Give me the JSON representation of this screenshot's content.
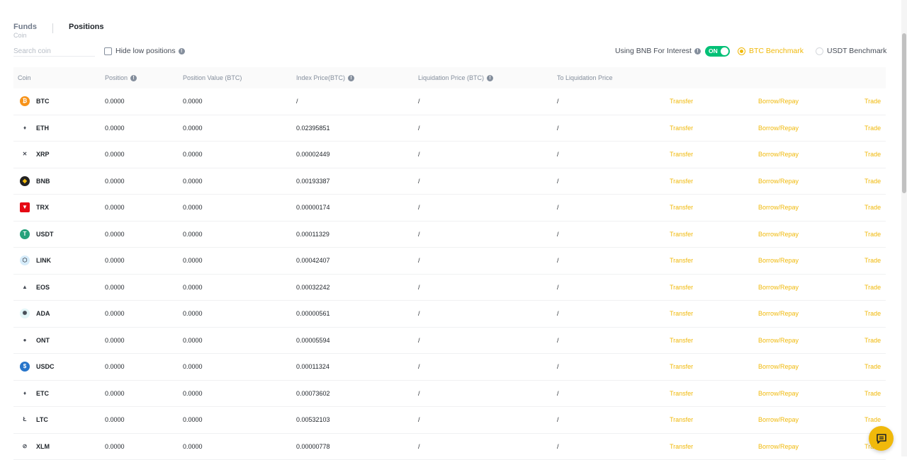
{
  "tabs": {
    "funds": "Funds",
    "funds_sub": "Coin",
    "positions": "Positions"
  },
  "search": {
    "placeholder": "Search coin"
  },
  "filters": {
    "hide_low": "Hide low positions",
    "bnb_interest": "Using BNB For Interest",
    "toggle": "ON",
    "btc_benchmark": "BTC Benchmark",
    "usdt_benchmark": "USDT Benchmark"
  },
  "colors": {
    "accent": "#f0b90b",
    "toggle_on": "#02c076"
  },
  "columns": {
    "coin": "Coin",
    "position": "Position",
    "position_value": "Position Value (BTC)",
    "index_price": "Index Price(BTC)",
    "liquidation_price": "Liquidation Price (BTC)",
    "to_liquidation": "To Liquidation Price"
  },
  "actions": {
    "transfer": "Transfer",
    "borrow": "Borrow/Repay",
    "trade": "Trade"
  },
  "rows": [
    {
      "coin": "BTC",
      "icon": "btc-icon",
      "color": "#f7931a",
      "glyph": "₿",
      "position": "0.0000",
      "value": "0.0000",
      "index": "/",
      "liq": "/",
      "to_liq": "/"
    },
    {
      "coin": "ETH",
      "icon": "eth-icon",
      "color": "#ffffff",
      "glyph": "♦",
      "position": "0.0000",
      "value": "0.0000",
      "index": "0.02395851",
      "liq": "/",
      "to_liq": "/"
    },
    {
      "coin": "XRP",
      "icon": "xrp-icon",
      "color": "#ffffff",
      "glyph": "✕",
      "position": "0.0000",
      "value": "0.0000",
      "index": "0.00002449",
      "liq": "/",
      "to_liq": "/"
    },
    {
      "coin": "BNB",
      "icon": "bnb-icon",
      "color": "#222222",
      "glyph": "◆",
      "position": "0.0000",
      "value": "0.0000",
      "index": "0.00193387",
      "liq": "/",
      "to_liq": "/"
    },
    {
      "coin": "TRX",
      "icon": "trx-icon",
      "color": "#e50914",
      "glyph": "▼",
      "position": "0.0000",
      "value": "0.0000",
      "index": "0.00000174",
      "liq": "/",
      "to_liq": "/"
    },
    {
      "coin": "USDT",
      "icon": "usdt-icon",
      "color": "#26a17b",
      "glyph": "T",
      "position": "0.0000",
      "value": "0.0000",
      "index": "0.00011329",
      "liq": "/",
      "to_liq": "/"
    },
    {
      "coin": "LINK",
      "icon": "link-icon",
      "color": "#d6ecfa",
      "glyph": "⬡",
      "position": "0.0000",
      "value": "0.0000",
      "index": "0.00042407",
      "liq": "/",
      "to_liq": "/"
    },
    {
      "coin": "EOS",
      "icon": "eos-icon",
      "color": "#ffffff",
      "glyph": "▲",
      "position": "0.0000",
      "value": "0.0000",
      "index": "0.00032242",
      "liq": "/",
      "to_liq": "/"
    },
    {
      "coin": "ADA",
      "icon": "ada-icon",
      "color": "#e3f6f8",
      "glyph": "✺",
      "position": "0.0000",
      "value": "0.0000",
      "index": "0.00000561",
      "liq": "/",
      "to_liq": "/"
    },
    {
      "coin": "ONT",
      "icon": "ont-icon",
      "color": "#ffffff",
      "glyph": "●",
      "position": "0.0000",
      "value": "0.0000",
      "index": "0.00005594",
      "liq": "/",
      "to_liq": "/"
    },
    {
      "coin": "USDC",
      "icon": "usdc-icon",
      "color": "#2775ca",
      "glyph": "$",
      "position": "0.0000",
      "value": "0.0000",
      "index": "0.00011324",
      "liq": "/",
      "to_liq": "/"
    },
    {
      "coin": "ETC",
      "icon": "etc-icon",
      "color": "#ffffff",
      "glyph": "♦",
      "position": "0.0000",
      "value": "0.0000",
      "index": "0.00073602",
      "liq": "/",
      "to_liq": "/"
    },
    {
      "coin": "LTC",
      "icon": "ltc-icon",
      "color": "#ffffff",
      "glyph": "Ł",
      "position": "0.0000",
      "value": "0.0000",
      "index": "0.00532103",
      "liq": "/",
      "to_liq": "/"
    },
    {
      "coin": "XLM",
      "icon": "xlm-icon",
      "color": "#ffffff",
      "glyph": "⊘",
      "position": "0.0000",
      "value": "0.0000",
      "index": "0.00000778",
      "liq": "/",
      "to_liq": "/"
    }
  ]
}
